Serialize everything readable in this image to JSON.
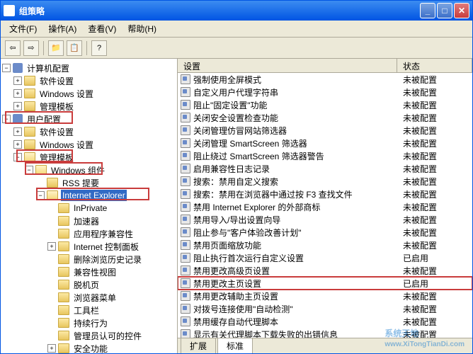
{
  "window": {
    "title": "组策略"
  },
  "menu": [
    "文件(F)",
    "操作(A)",
    "查看(V)",
    "帮助(H)"
  ],
  "list_header": {
    "col_setting": "设置",
    "col_state": "状态"
  },
  "tree": {
    "root": "计算机配置",
    "n_software": "软件设置",
    "n_windows": "Windows 设置",
    "n_admin": "管理模板",
    "user_config": "用户配置",
    "u_software": "软件设置",
    "u_windows": "Windows 设置",
    "u_admin": "管理模板",
    "win_comp": "Windows 组件",
    "rss": "RSS 提要",
    "ie": "Internet Explorer",
    "inprivate": "InPrivate",
    "accel": "加速器",
    "compat": "应用程序兼容性",
    "iecp": "Internet 控制面板",
    "delhist": "删除浏览历史记录",
    "compatview": "兼容性视图",
    "detach": "脱机页",
    "browsermenu": "浏览器菜单",
    "toolbar": "工具栏",
    "persist": "持续行为",
    "admincontrols": "管理员认可的控件",
    "security": "安全功能"
  },
  "settings": [
    {
      "name": "强制使用全屏模式",
      "state": "未被配置"
    },
    {
      "name": "自定义用户代理字符串",
      "state": "未被配置"
    },
    {
      "name": "阻止\"固定设置\"功能",
      "state": "未被配置"
    },
    {
      "name": "关闭安全设置检查功能",
      "state": "未被配置"
    },
    {
      "name": "关闭管理仿冒网站筛选器",
      "state": "未被配置"
    },
    {
      "name": "关闭管理 SmartScreen 筛选器",
      "state": "未被配置"
    },
    {
      "name": "阻止绕过 SmartScreen 筛选器警告",
      "state": "未被配置"
    },
    {
      "name": "启用兼容性日志记录",
      "state": "未被配置"
    },
    {
      "name": "搜索：禁用自定义搜索",
      "state": "未被配置"
    },
    {
      "name": "搜索：禁用在浏览器中通过按 F3 查找文件",
      "state": "未被配置"
    },
    {
      "name": "禁用 Internet Explorer 的外部商标",
      "state": "未被配置"
    },
    {
      "name": "禁用导入/导出设置向导",
      "state": "未被配置"
    },
    {
      "name": "阻止参与\"客户体验改善计划\"",
      "state": "未被配置"
    },
    {
      "name": "禁用页面缩放功能",
      "state": "未被配置"
    },
    {
      "name": "阻止执行首次运行自定义设置",
      "state": "已启用"
    },
    {
      "name": "禁用更改高级页设置",
      "state": "未被配置"
    },
    {
      "name": "禁用更改主页设置",
      "state": "已启用",
      "hl": true
    },
    {
      "name": "禁用更改辅助主页设置",
      "state": "未被配置"
    },
    {
      "name": "对拨号连接使用\"自动检测\"",
      "state": "未被配置"
    },
    {
      "name": "禁用缓存自动代理脚本",
      "state": "未被配置"
    },
    {
      "name": "显示有关代理脚本下载失败的出错信息",
      "state": "未被配置"
    }
  ],
  "tabs": {
    "ext": "扩展",
    "std": "标准"
  },
  "watermark": {
    "brand": "系统天地",
    "url": "www.XiTongTianDi.com"
  }
}
